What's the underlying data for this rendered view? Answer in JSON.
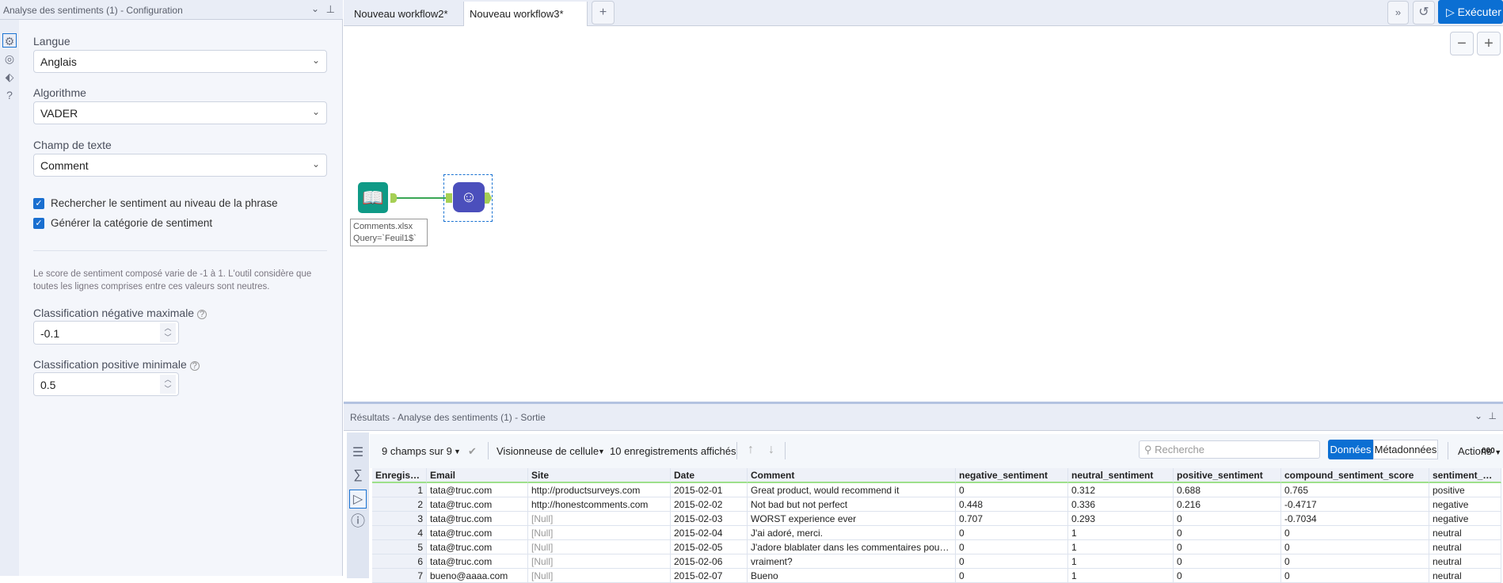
{
  "config_panel": {
    "title": "Analyse des sentiments (1) - Configuration",
    "language_label": "Langue",
    "language_value": "Anglais",
    "algorithm_label": "Algorithme",
    "algorithm_value": "VADER",
    "text_field_label": "Champ de texte",
    "text_field_value": "Comment",
    "checkbox_sentence": "Rechercher le sentiment au niveau de la phrase",
    "checkbox_category": "Générer la catégorie de sentiment",
    "description": "Le score de sentiment composé varie de -1 à 1. L'outil considère que toutes les lignes comprises entre ces valeurs sont neutres.",
    "neg_label": "Classification négative maximale",
    "neg_value": "-0.1",
    "pos_label": "Classification positive minimale",
    "pos_value": "0.5"
  },
  "tabs": [
    "Nouveau workflow2*",
    "Nouveau workflow3*"
  ],
  "toolbar": {
    "run_label": "Exécuter"
  },
  "canvas": {
    "input_label_line1": "Comments.xlsx",
    "input_label_line2": "Query=`Feuil1$`"
  },
  "results": {
    "title": "Résultats - Analyse des sentiments (1) - Sortie",
    "fields": "9 champs sur 9",
    "viewer": "Visionneuse de cellule",
    "records": "10 enregistrements affichés",
    "search_placeholder": "Recherche",
    "data_btn": "Données",
    "meta_btn": "Métadonnées",
    "actions": "Actions",
    "more": "000",
    "columns": [
      "Enregistr...",
      "Email",
      "Site",
      "Date",
      "Comment",
      "negative_sentiment",
      "neutral_sentiment",
      "positive_sentiment",
      "compound_sentiment_score",
      "sentiment_categ"
    ],
    "rows": [
      [
        "1",
        "tata@truc.com",
        "http://productsurveys.com",
        "2015-02-01",
        "Great product,  would recommend it",
        "0",
        "0.312",
        "0.688",
        "0.765",
        "positive"
      ],
      [
        "2",
        "tata@truc.com",
        "http://honestcomments.com",
        "2015-02-02",
        "Not bad but not perfect",
        "0.448",
        "0.336",
        "0.216",
        "-0.4717",
        "negative"
      ],
      [
        "3",
        "tata@truc.com",
        "[Null]",
        "2015-02-03",
        "WORST experience ever",
        "0.707",
        "0.293",
        "0",
        "-0.7034",
        "negative"
      ],
      [
        "4",
        "tata@truc.com",
        "[Null]",
        "2015-02-04",
        "J'ai adoré, merci.",
        "0",
        "1",
        "0",
        "0",
        "neutral"
      ],
      [
        "5",
        "tata@truc.com",
        "[Null]",
        "2015-02-05",
        "J'adore blablater dans les commentaires pour po...",
        "0",
        "1",
        "0",
        "0",
        "neutral"
      ],
      [
        "6",
        "tata@truc.com",
        "[Null]",
        "2015-02-06",
        "vraiment?",
        "0",
        "1",
        "0",
        "0",
        "neutral"
      ],
      [
        "7",
        "bueno@aaaa.com",
        "[Null]",
        "2015-02-07",
        "Bueno",
        "0",
        "1",
        "0",
        "0",
        "neutral"
      ]
    ]
  }
}
